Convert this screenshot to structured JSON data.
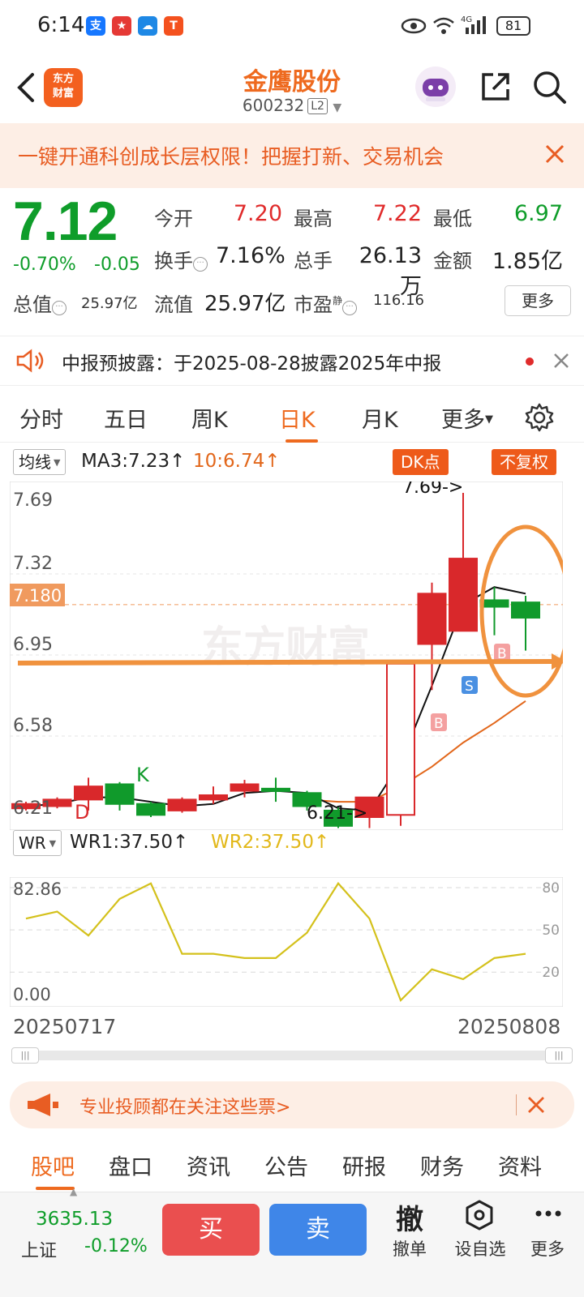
{
  "status": {
    "time": "6:14",
    "battery": "81",
    "network": "4G"
  },
  "header": {
    "stock_name": "金鹰股份",
    "stock_code": "600232",
    "level": "L2",
    "logo_line1": "东方",
    "logo_line2": "财富"
  },
  "promo": {
    "text": "一键开通科创成长层权限！把握打新、交易机会"
  },
  "quote": {
    "price": "7.12",
    "change_pct": "-0.70%",
    "change": "-0.05",
    "open_label": "今开",
    "open": "7.20",
    "high_label": "最高",
    "high": "7.22",
    "low_label": "最低",
    "low": "6.97",
    "turnover_label": "换手",
    "turnover": "7.16%",
    "volume_label": "总手",
    "volume": "26.13万",
    "amount_label": "金额",
    "amount": "1.85亿",
    "mcap_label": "总值",
    "mcap": "25.97亿",
    "float_label": "流值",
    "float_cap": "25.97亿",
    "pe_label": "市盈",
    "pe_sup": "静",
    "pe": "116.16",
    "more": "更多"
  },
  "notice": {
    "text": "中报预披露：于2025-08-28披露2025年中报"
  },
  "chart_tabs": [
    "分时",
    "五日",
    "周K",
    "日K",
    "月K",
    "更多"
  ],
  "active_chart_tab": "日K",
  "indicators": {
    "ma_select": "均线",
    "ma3": "MA3:7.23↑",
    "ma10": "10:6.74↑",
    "dk_btn": "DK点",
    "adjust_btn": "不复权",
    "wr_select": "WR",
    "wr1": "WR1:37.50↑",
    "wr2": "WR2:37.50↑"
  },
  "kline": {
    "y_ticks": [
      "7.69",
      "7.32",
      "6.95",
      "6.58",
      "6.21"
    ],
    "current_price_tag": "7.180",
    "high_annot": "7.69->",
    "low_annot": "6.21->",
    "watermark": "东方财富",
    "markers": {
      "D": "D",
      "K": "K",
      "B": "B",
      "S": "S"
    },
    "colors": {
      "up": "#d9282b",
      "down": "#109a2b",
      "ma3": "#111111",
      "ma10": "#e2671b",
      "highlight": "#f0923e"
    }
  },
  "wr": {
    "y_ticks_left": [
      "82.86",
      "0.00"
    ],
    "y_ticks_right": [
      "80",
      "50",
      "20"
    ],
    "date_start": "20250717",
    "date_end": "20250808"
  },
  "chart_data": [
    {
      "type": "candlestick",
      "ylim": [
        6.21,
        7.69
      ],
      "candles": [
        {
          "o": 6.25,
          "c": 6.27,
          "h": 6.28,
          "l": 6.24
        },
        {
          "o": 6.26,
          "c": 6.29,
          "h": 6.3,
          "l": 6.25
        },
        {
          "o": 6.29,
          "c": 6.35,
          "h": 6.39,
          "l": 6.24
        },
        {
          "o": 6.36,
          "c": 6.27,
          "h": 6.37,
          "l": 6.24
        },
        {
          "o": 6.27,
          "c": 6.22,
          "h": 6.28,
          "l": 6.21
        },
        {
          "o": 6.24,
          "c": 6.29,
          "h": 6.3,
          "l": 6.23
        },
        {
          "o": 6.29,
          "c": 6.31,
          "h": 6.35,
          "l": 6.27
        },
        {
          "o": 6.33,
          "c": 6.36,
          "h": 6.38,
          "l": 6.3
        },
        {
          "o": 6.34,
          "c": 6.33,
          "h": 6.39,
          "l": 6.28
        },
        {
          "o": 6.32,
          "c": 6.26,
          "h": 6.33,
          "l": 6.24
        },
        {
          "o": 6.24,
          "c": 6.17,
          "h": 6.26,
          "l": 6.16
        },
        {
          "o": 6.21,
          "c": 6.3,
          "h": 6.3,
          "l": 6.16
        },
        {
          "o": 6.22,
          "c": 6.91,
          "h": 6.91,
          "l": 6.17
        },
        {
          "o": 7.0,
          "c": 7.23,
          "h": 7.28,
          "l": 6.79
        },
        {
          "o": 7.06,
          "c": 7.39,
          "h": 7.69,
          "l": 7.06
        },
        {
          "o": 7.2,
          "c": 7.17,
          "h": 7.26,
          "l": 7.04
        },
        {
          "o": 7.19,
          "c": 7.12,
          "h": 7.22,
          "l": 6.97
        }
      ],
      "ma3": [
        6.26,
        6.27,
        6.3,
        6.3,
        6.28,
        6.26,
        6.27,
        6.32,
        6.33,
        6.32,
        6.25,
        6.24,
        6.46,
        6.81,
        7.18,
        7.26,
        7.23
      ],
      "ma10": [
        null,
        null,
        null,
        null,
        null,
        null,
        null,
        null,
        null,
        6.29,
        6.28,
        6.28,
        6.35,
        6.44,
        6.55,
        6.64,
        6.74
      ],
      "watch_line": 6.95
    },
    {
      "type": "line",
      "title": "WR",
      "ylim": [
        0,
        82.86
      ],
      "series": [
        {
          "name": "WR1",
          "values": [
            58,
            63,
            46,
            72,
            83,
            33,
            33,
            30,
            30,
            48,
            83,
            58,
            0,
            22,
            15,
            30,
            33
          ]
        }
      ]
    }
  ],
  "slider": {
    "handle": "|||"
  },
  "ad": {
    "text": "专业投顾都在关注这些票>"
  },
  "bottom_tabs": [
    "股吧",
    "盘口",
    "资讯",
    "公告",
    "研报",
    "财务",
    "资料"
  ],
  "toolbar": {
    "index_value": "3635.13",
    "index_name": "上证",
    "index_change": "-0.12%",
    "buy": "买",
    "sell": "卖",
    "cancel_icon": "撤",
    "cancel_label": "撤单",
    "watch_label": "设自选",
    "more_label": "更多"
  }
}
